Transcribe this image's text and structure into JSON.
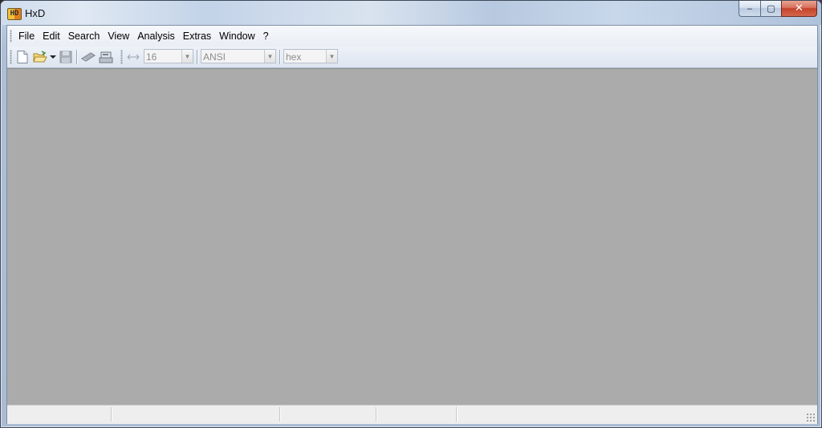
{
  "window": {
    "title": "HxD",
    "icon": "hxd-app-icon",
    "icon_glyph": "HD",
    "controls": {
      "minimize_icon": "minimize-icon",
      "maximize_icon": "maximize-icon",
      "close_icon": "close-icon",
      "minimize_glyph": "‒",
      "maximize_glyph": "▢",
      "close_glyph": "✕"
    }
  },
  "menu": {
    "items": [
      "File",
      "Edit",
      "Search",
      "View",
      "Analysis",
      "Extras",
      "Window",
      "?"
    ]
  },
  "toolbar": {
    "icons": [
      "new-file-icon",
      "open-file-icon",
      "open-dropdown-arrow-icon",
      "save-icon",
      "open-ram-icon",
      "open-disk-icon",
      "bytes-per-row-icon"
    ],
    "bytes_per_row": "16",
    "charset": "ANSI",
    "offset_base": "hex"
  },
  "colors": {
    "workspace_bg": "#ababab",
    "titlebar_accent": "#c6d6ea",
    "close_button": "#c4432b"
  }
}
